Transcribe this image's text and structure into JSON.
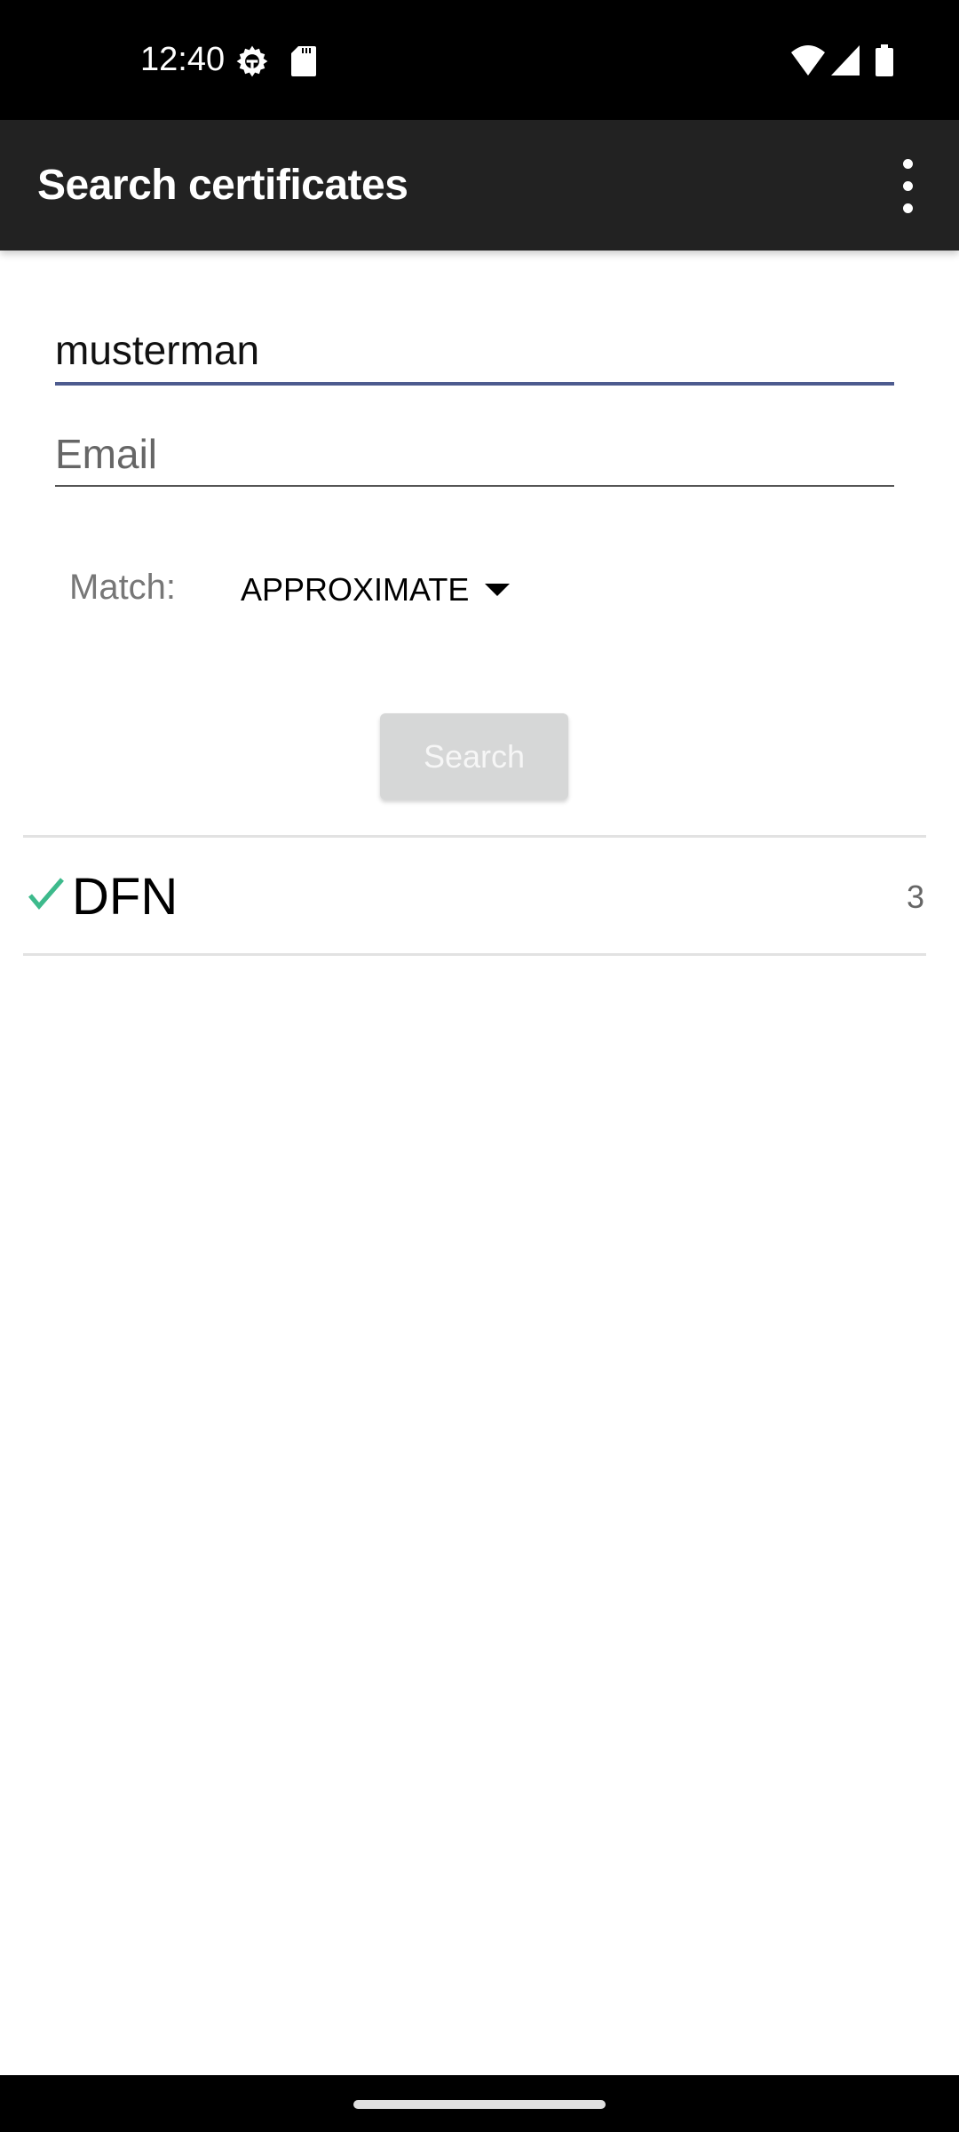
{
  "status_bar": {
    "time": "12:40",
    "icons": [
      "gear-icon",
      "sd-card-icon",
      "wifi-icon",
      "signal-icon",
      "battery-icon"
    ]
  },
  "app_bar": {
    "title": "Search certificates",
    "menu_icon": "more-vert-icon"
  },
  "form": {
    "name_value": "musterman",
    "email_placeholder": "Email",
    "match_label": "Match:",
    "match_value": "APPROXIMATE",
    "search_label": "Search"
  },
  "results": [
    {
      "provider": "DFN",
      "count": "3",
      "status_icon": "check-icon"
    }
  ],
  "colors": {
    "accent": "#4d5b8f",
    "check": "#3dba8c",
    "app_bar": "#222222"
  }
}
